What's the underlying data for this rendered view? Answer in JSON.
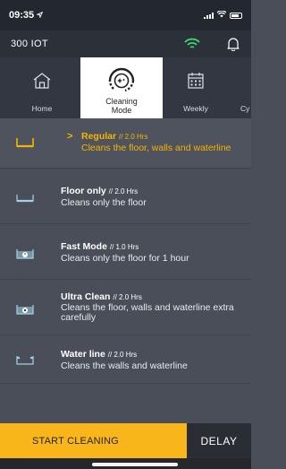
{
  "status_bar": {
    "time": "09:35",
    "location_icon": "location-arrow-icon",
    "signal_icon": "cellular-signal-icon",
    "wifi_icon": "wifi-icon",
    "battery_icon": "battery-icon"
  },
  "header": {
    "device_name": "300 IOT",
    "wifi_icon": "wifi-icon",
    "bell_icon": "bell-icon",
    "wifi_color": "#3ad96b"
  },
  "tabs": [
    {
      "label": "Home",
      "icon": "home-icon",
      "active": false
    },
    {
      "label": "Cleaning Mode",
      "icon": "cleaning-mode-icon",
      "active": true
    },
    {
      "label": "Weekly",
      "icon": "calendar-icon",
      "active": false
    },
    {
      "label": "Cy",
      "icon": "",
      "active": false
    }
  ],
  "modes": [
    {
      "title": "Regular",
      "hours": "// 2.0 Hrs",
      "description": "Cleans the floor, walls and waterline",
      "icon": "regular-mode-icon",
      "selected": true
    },
    {
      "title": "Floor only",
      "hours": "// 2.0 Hrs",
      "description": "Cleans only the floor",
      "icon": "floor-only-icon",
      "selected": false
    },
    {
      "title": "Fast Mode",
      "hours": "// 1.0 Hrs",
      "description": "Cleans only the floor for 1 hour",
      "icon": "fast-mode-icon",
      "selected": false
    },
    {
      "title": "Ultra Clean",
      "hours": "// 2.0 Hrs",
      "description": "Cleans the floor, walls and waterline extra carefully",
      "icon": "ultra-clean-icon",
      "selected": false
    },
    {
      "title": "Water line",
      "hours": "// 2.0 Hrs",
      "description": "Cleans the walls and waterline",
      "icon": "water-line-icon",
      "selected": false
    }
  ],
  "selected_chevron": ">",
  "footer": {
    "start_label": "START CLEANING",
    "delay_label": "DELAY"
  },
  "colors": {
    "accent": "#f8b61a",
    "selected_text": "#f5b400",
    "background": "#4a4e59",
    "header_bg": "#2c3039"
  }
}
